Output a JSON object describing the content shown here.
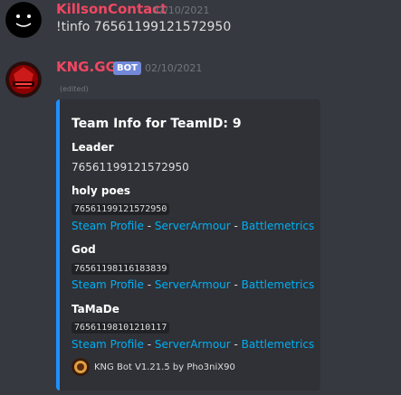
{
  "messages": [
    {
      "author": "KillsonContact",
      "timestamp": "02/10/2021",
      "content": "!tinfo 76561199121572950",
      "avatar_icon": "black-smiley-avatar"
    },
    {
      "author": "KNG.GG",
      "badge": "BOT",
      "timestamp": "02/10/2021",
      "edited": "(edited)",
      "avatar_icon": "kng-red-logo-avatar",
      "embed": {
        "accent_color": "#1e90ff",
        "title": "Team Info for TeamID: 9",
        "leader": {
          "name": "Leader",
          "value": "76561199121572950"
        },
        "members": [
          {
            "name": "holy poes",
            "steamid": "76561199121572950",
            "links": [
              "Steam Profile",
              "ServerArmour",
              "Battlemetrics"
            ]
          },
          {
            "name": "God",
            "steamid": "76561198116183839",
            "links": [
              "Steam Profile",
              "ServerArmour",
              "Battlemetrics"
            ]
          },
          {
            "name": "TaMaDe",
            "steamid": "76561198101210117",
            "links": [
              "Steam Profile",
              "ServerArmour",
              "Battlemetrics"
            ]
          }
        ],
        "link_separator": " - ",
        "footer": {
          "icon": "kng-bot-footer-icon",
          "text": "KNG Bot V1.21.5 by Pho3niX90"
        }
      }
    }
  ],
  "colors": {
    "background": "#36393f",
    "embed_background": "#2f3136",
    "author": "#f04763",
    "link": "#00aff4",
    "bot_badge": "#7289da"
  }
}
